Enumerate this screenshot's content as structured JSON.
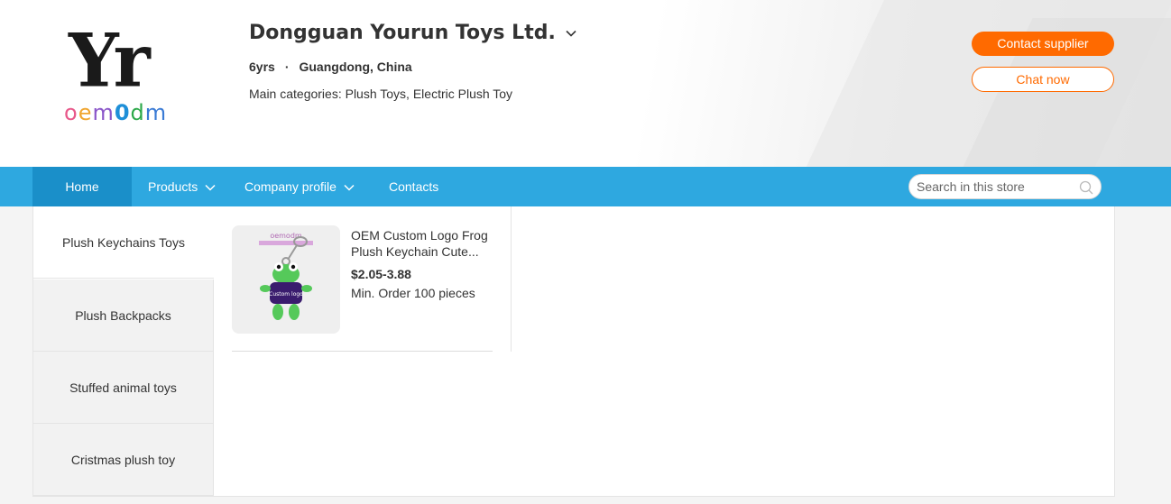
{
  "header": {
    "logo": {
      "mark": "Yr",
      "wordmark": [
        "o",
        "e",
        "m",
        "0",
        "d",
        "m"
      ]
    },
    "company_name": "Dongguan Yourun Toys Ltd.",
    "years": "6yrs",
    "separator": "·",
    "location": "Guangdong, China",
    "categories": "Main categories: Plush Toys, Electric Plush Toy",
    "contact_button": "Contact supplier",
    "chat_button": "Chat now"
  },
  "nav": {
    "home": "Home",
    "products": "Products",
    "company_profile": "Company profile",
    "contacts": "Contacts",
    "search_placeholder": "Search in this store"
  },
  "sidebar": {
    "items": [
      {
        "label": "Plush Keychains Toys",
        "active": true
      },
      {
        "label": "Plush Backpacks",
        "active": false
      },
      {
        "label": "Stuffed animal toys",
        "active": false
      },
      {
        "label": "Cristmas plush toy",
        "active": false
      }
    ]
  },
  "products": [
    {
      "title": "OEM Custom Logo Frog Plush Keychain Cute...",
      "price": "$2.05-3.88",
      "moq": "Min. Order 100 pieces",
      "image_text": {
        "brand": "oemodm",
        "shirt": "Custom logo"
      }
    }
  ],
  "colors": {
    "accent_orange": "#ff6a00",
    "nav_blue": "#2ea8e0",
    "nav_active": "#1a8fc9"
  }
}
